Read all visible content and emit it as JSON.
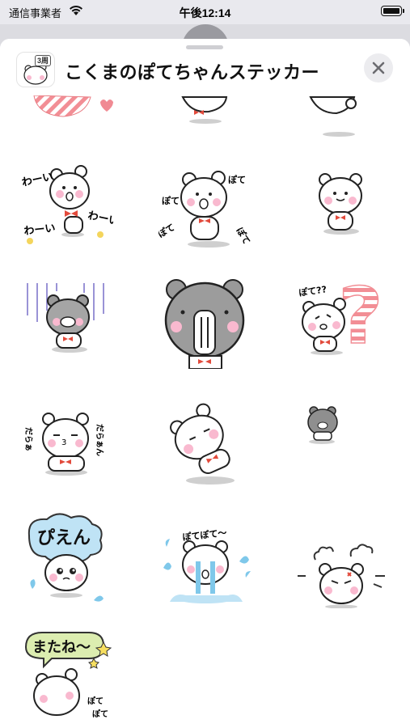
{
  "status_bar": {
    "carrier": "通信事業者",
    "time": "午後12:14",
    "wifi_icon": "wifi-icon",
    "battery_icon": "battery-icon"
  },
  "sheet": {
    "title": "こくまのぽてちゃんステッカー",
    "pack_badge": "3周",
    "close_icon": "close-icon"
  },
  "stickers": [
    {
      "id": "partial-1",
      "texts": []
    },
    {
      "id": "partial-2",
      "texts": []
    },
    {
      "id": "partial-3",
      "texts": []
    },
    {
      "id": "wai-wai",
      "texts": [
        "わーい",
        "わーい",
        "わーい"
      ]
    },
    {
      "id": "pote-pote-walk",
      "texts": [
        "ぽて",
        "ぽて",
        "ぽて",
        "ぽて"
      ]
    },
    {
      "id": "bear-standing",
      "texts": []
    },
    {
      "id": "gloomy-bear",
      "texts": []
    },
    {
      "id": "shocked-gray-bear",
      "texts": []
    },
    {
      "id": "question-bear",
      "texts": [
        "ぽて??",
        "?"
      ]
    },
    {
      "id": "sleeping-bear",
      "texts": [
        "だらぁ",
        "だらぁん"
      ]
    },
    {
      "id": "lying-bear",
      "texts": []
    },
    {
      "id": "small-gray-bear",
      "texts": []
    },
    {
      "id": "pien-bear",
      "texts": [
        "ぴえん"
      ]
    },
    {
      "id": "crying-bear",
      "texts": [
        "ぽてぽて〜"
      ]
    },
    {
      "id": "angry-bear",
      "texts": []
    },
    {
      "id": "matane-bear",
      "texts": [
        "またね〜",
        "ぽて",
        "ぽて"
      ]
    }
  ]
}
